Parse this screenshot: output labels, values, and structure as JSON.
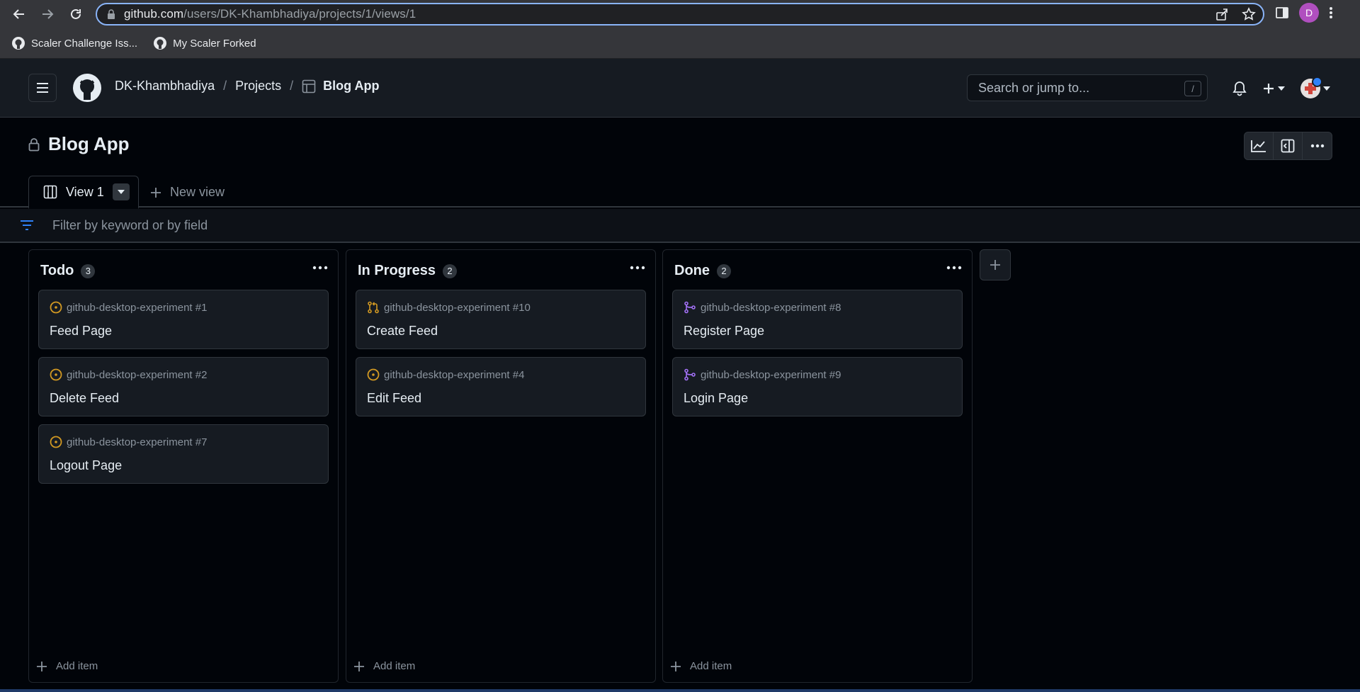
{
  "browser": {
    "url_host": "github.com",
    "url_path": "/users/DK-Khambhadiya/projects/1/views/1",
    "profile_initial": "D",
    "bookmarks": [
      {
        "label": "Scaler Challenge Iss..."
      },
      {
        "label": "My Scaler Forked"
      }
    ]
  },
  "header": {
    "breadcrumb": {
      "user": "DK-Khambhadiya",
      "sep1": "/",
      "projects": "Projects",
      "sep2": "/",
      "project": "Blog App"
    },
    "search_placeholder": "Search or jump to...",
    "search_shortcut": "/"
  },
  "project": {
    "title": "Blog App",
    "tabs": [
      {
        "label": "View 1"
      }
    ],
    "new_view_label": "New view",
    "filter_placeholder": "Filter by keyword or by field"
  },
  "columns": [
    {
      "name": "Todo",
      "count": "3",
      "add_label": "Add item",
      "cards": [
        {
          "meta": "github-desktop-experiment #1",
          "title": "Feed Page",
          "icon": "issue-open-icon"
        },
        {
          "meta": "github-desktop-experiment #2",
          "title": "Delete Feed",
          "icon": "issue-open-icon"
        },
        {
          "meta": "github-desktop-experiment #7",
          "title": "Logout Page",
          "icon": "issue-open-icon"
        }
      ]
    },
    {
      "name": "In Progress",
      "count": "2",
      "add_label": "Add item",
      "cards": [
        {
          "meta": "github-desktop-experiment #10",
          "title": "Create Feed",
          "icon": "pull-request-icon"
        },
        {
          "meta": "github-desktop-experiment #4",
          "title": "Edit Feed",
          "icon": "issue-open-icon"
        }
      ]
    },
    {
      "name": "Done",
      "count": "2",
      "add_label": "Add item",
      "cards": [
        {
          "meta": "github-desktop-experiment #8",
          "title": "Register Page",
          "icon": "merged-icon"
        },
        {
          "meta": "github-desktop-experiment #9",
          "title": "Login Page",
          "icon": "merged-icon"
        }
      ]
    }
  ],
  "colors": {
    "issue_open": "#d29922",
    "pull_request": "#d29922",
    "merged": "#a371f7",
    "accent": "#2f81f7"
  }
}
